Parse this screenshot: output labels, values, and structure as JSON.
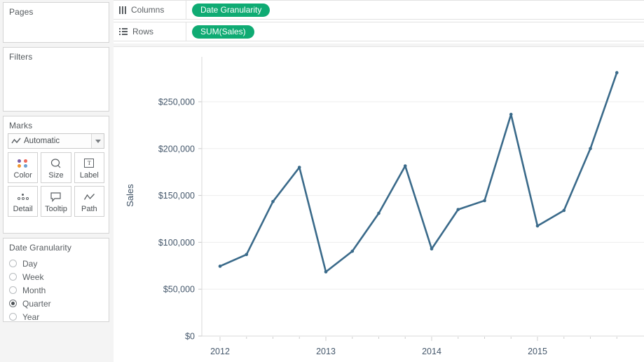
{
  "colors": {
    "pill_green": "#0fab73",
    "line_blue": "#3a6a8a",
    "panel_bg": "#f4f4f4",
    "card_bg": "#ffffff",
    "border": "#d4d4d4",
    "axis_text": "#44576b",
    "gridline": "#ededed"
  },
  "left_panel": {
    "pages": {
      "title": "Pages"
    },
    "filters": {
      "title": "Filters"
    },
    "marks": {
      "title": "Marks",
      "mark_type": "Automatic",
      "mark_type_icon": "line-chart-icon",
      "buttons": [
        {
          "label": "Color",
          "icon": "color-dots-icon"
        },
        {
          "label": "Size",
          "icon": "size-circle-icon"
        },
        {
          "label": "Label",
          "icon": "label-text-icon"
        },
        {
          "label": "Detail",
          "icon": "detail-dots-icon"
        },
        {
          "label": "Tooltip",
          "icon": "tooltip-bubble-icon"
        },
        {
          "label": "Path",
          "icon": "path-line-icon"
        }
      ],
      "color_dots": [
        "#7b5ea7",
        "#ee6a5b",
        "#f0962d",
        "#6c9fd0"
      ]
    },
    "legend": {
      "title": "Date Granularity",
      "options": [
        {
          "label": "Day",
          "selected": false
        },
        {
          "label": "Week",
          "selected": false
        },
        {
          "label": "Month",
          "selected": false
        },
        {
          "label": "Quarter",
          "selected": true
        },
        {
          "label": "Year",
          "selected": false
        }
      ]
    }
  },
  "shelves": {
    "columns": {
      "label": "Columns",
      "icon": "columns-icon",
      "pill": "Date Granularity"
    },
    "rows": {
      "label": "Rows",
      "icon": "rows-icon",
      "pill": "SUM(Sales)"
    }
  },
  "chart_data": {
    "type": "line",
    "title": "",
    "xlabel": "",
    "ylabel": "Sales",
    "ylim": [
      0,
      290000
    ],
    "ytick_labels": [
      "$0",
      "$50,000",
      "$100,000",
      "$150,000",
      "$200,000",
      "$250,000"
    ],
    "ytick_values": [
      0,
      50000,
      100000,
      150000,
      200000,
      250000
    ],
    "xtick_labels": [
      "2012",
      "2013",
      "2014",
      "2015"
    ],
    "grid": true,
    "legend": "none",
    "marker": "circle",
    "line_color": "#3a6a8a",
    "x": [
      "2012 Q1",
      "2012 Q2",
      "2012 Q3",
      "2012 Q4",
      "2013 Q1",
      "2013 Q2",
      "2013 Q3",
      "2013 Q4",
      "2014 Q1",
      "2014 Q2",
      "2014 Q3",
      "2014 Q4",
      "2015 Q1",
      "2015 Q2",
      "2015 Q3",
      "2015 Q4"
    ],
    "values": [
      74500,
      87000,
      143500,
      180000,
      68500,
      90500,
      131000,
      181500,
      93000,
      135000,
      144500,
      236500,
      117500,
      134000,
      200000,
      281000
    ]
  }
}
